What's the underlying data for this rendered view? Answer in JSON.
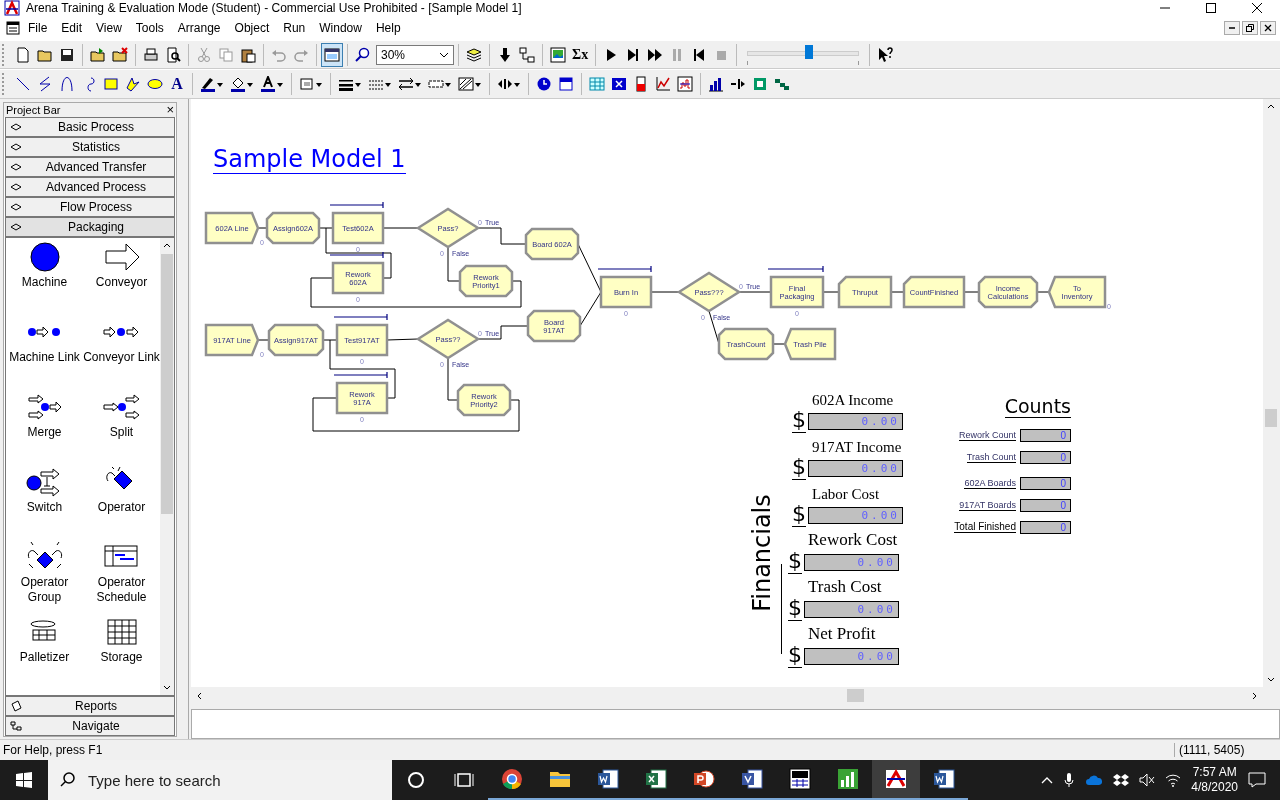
{
  "window": {
    "title": "Arena Training & Evaluation Mode (Student) - Commercial Use Prohibited - [Sample Model 1]"
  },
  "menu": [
    "File",
    "Edit",
    "View",
    "Tools",
    "Arrange",
    "Object",
    "Run",
    "Window",
    "Help"
  ],
  "toolbar": {
    "zoom": "30%",
    "sum_tool": "Σx",
    "text_tool": "A",
    "speed_slider": {
      "level": 0.55
    }
  },
  "project_bar": {
    "title": "Project Bar",
    "close": "×",
    "panels": [
      {
        "label": "Basic Process",
        "selected": false
      },
      {
        "label": "Statistics",
        "selected": false
      },
      {
        "label": "Advanced Transfer",
        "selected": false
      },
      {
        "label": "Advanced Process",
        "selected": false
      },
      {
        "label": "Flow Process",
        "selected": false
      },
      {
        "label": "Packaging",
        "selected": true
      }
    ],
    "modules": [
      {
        "label": "Machine",
        "kind": "circle"
      },
      {
        "label": "Conveyor",
        "kind": "arrow"
      },
      {
        "label": "Machine Link",
        "kind": "dot-link"
      },
      {
        "label": "Conveyor Link",
        "kind": "arrow-link"
      },
      {
        "label": "Merge",
        "kind": "merge"
      },
      {
        "label": "Split",
        "kind": "split"
      },
      {
        "label": "Switch",
        "kind": "switch"
      },
      {
        "label": "Operator",
        "kind": "operator"
      },
      {
        "label": "Operator Group",
        "kind": "operator-group"
      },
      {
        "label": "Operator Schedule",
        "kind": "schedule"
      },
      {
        "label": "Palletizer",
        "kind": "palletizer"
      },
      {
        "label": "Storage",
        "kind": "storage"
      }
    ],
    "bottom_panels": [
      {
        "label": "Reports",
        "kind": "reports"
      },
      {
        "label": "Navigate",
        "kind": "navigate"
      }
    ]
  },
  "model": {
    "title": "Sample Model 1",
    "modules": [
      {
        "label": "602A Line",
        "kind": "create",
        "count": "0"
      },
      {
        "label": "Assign602A",
        "kind": "assign"
      },
      {
        "label": "Test602A",
        "kind": "process",
        "count": "0"
      },
      {
        "label": "Pass?",
        "kind": "decide",
        "outputs": [
          {
            "label": "True",
            "count": "0"
          },
          {
            "label": "False",
            "count": "0"
          }
        ]
      },
      {
        "label": "Board 602A",
        "kind": "assign"
      },
      {
        "label": "Rework 602A",
        "kind": "process",
        "count": "0"
      },
      {
        "label": "Rework Priority1",
        "kind": "assign"
      },
      {
        "label": "917AT Line",
        "kind": "create",
        "count": "0"
      },
      {
        "label": "Assign917AT",
        "kind": "assign"
      },
      {
        "label": "Test917AT",
        "kind": "process",
        "count": "0"
      },
      {
        "label": "Pass??",
        "kind": "decide",
        "outputs": [
          {
            "label": "True",
            "count": "0"
          },
          {
            "label": "False",
            "count": "0"
          }
        ]
      },
      {
        "label": "Board 917AT",
        "kind": "assign"
      },
      {
        "label": "Rework 917A",
        "kind": "process",
        "count": "0"
      },
      {
        "label": "Rework Priority2",
        "kind": "assign"
      },
      {
        "label": "Burn In",
        "kind": "process",
        "count": "0"
      },
      {
        "label": "Pass???",
        "kind": "decide",
        "outputs": [
          {
            "label": "True",
            "count": "0"
          },
          {
            "label": "False",
            "count": "0"
          }
        ]
      },
      {
        "label": "Final Packaging",
        "kind": "process",
        "count": "0"
      },
      {
        "label": "Thruput",
        "kind": "record"
      },
      {
        "label": "CountFinished",
        "kind": "record"
      },
      {
        "label": "Income Calculations",
        "kind": "assign"
      },
      {
        "label": "To Inventory",
        "kind": "dispose",
        "count": "0"
      },
      {
        "label": "TrashCount",
        "kind": "assign"
      },
      {
        "label": "Trash Pile",
        "kind": "dispose"
      }
    ]
  },
  "financials": {
    "title": "Financials",
    "items": [
      {
        "label": "602A Income",
        "currency": "$",
        "value": "0.00"
      },
      {
        "label": "917AT Income",
        "currency": "$",
        "value": "0.00"
      },
      {
        "label": "Labor Cost",
        "currency": "$",
        "value": "0.00"
      },
      {
        "label": "Rework Cost",
        "currency": "$",
        "value": "0.00"
      },
      {
        "label": "Trash Cost",
        "currency": "$",
        "value": "0.00"
      },
      {
        "label": "Net Profit",
        "currency": "$",
        "value": "0.00"
      }
    ]
  },
  "counts": {
    "title": "Counts",
    "items": [
      {
        "label": "Rework Count",
        "value": "0"
      },
      {
        "label": "Trash Count",
        "value": "0"
      },
      {
        "label": "602A Boards",
        "value": "0"
      },
      {
        "label": "917AT Boards",
        "value": "0"
      },
      {
        "label": "Total Finished",
        "value": "0"
      }
    ]
  },
  "status_bar": {
    "help": "For Help, press F1",
    "coords": "(1111, 5405)"
  },
  "taskbar": {
    "search": {
      "placeholder": "Type here to search"
    },
    "time": "7:57 AM",
    "date": "4/8/2020",
    "apps": [
      {
        "kind": "browser",
        "selected": false
      },
      {
        "kind": "folder",
        "selected": false
      },
      {
        "kind": "word",
        "selected": false
      },
      {
        "kind": "excel",
        "selected": false
      },
      {
        "kind": "powerpoint",
        "selected": false
      },
      {
        "kind": "visio",
        "selected": false
      },
      {
        "kind": "grid-app",
        "selected": false
      },
      {
        "kind": "chart-app",
        "selected": false
      },
      {
        "kind": "arena",
        "selected": true
      },
      {
        "kind": "word",
        "selected": false
      }
    ]
  }
}
